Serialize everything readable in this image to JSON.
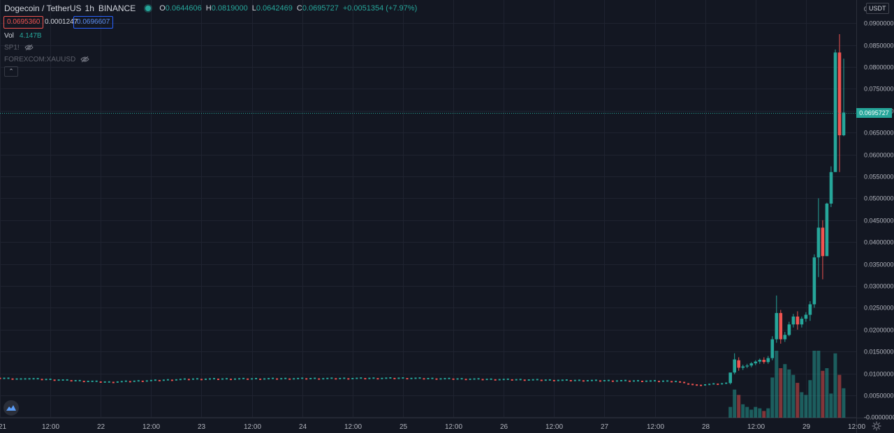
{
  "header": {
    "symbol": "Dogecoin / TetherUS",
    "interval": "1h",
    "exchange": "BINANCE",
    "ohlc": [
      {
        "label": "O",
        "value": "0.0644606"
      },
      {
        "label": "H",
        "value": "0.0819000"
      },
      {
        "label": "L",
        "value": "0.0642469"
      },
      {
        "label": "C",
        "value": "0.0695727"
      }
    ],
    "change": "+0.0051354 (+7.97%)"
  },
  "price_boxes": {
    "bid": "0.0695360",
    "spread": "0.0001247",
    "ask": "0.0696607"
  },
  "studies": {
    "vol_label": "Vol",
    "vol_value": "4.147B",
    "sp1": "SP1!",
    "xau": "FOREXCOM:XAUUSD"
  },
  "currency_badge": "USDT",
  "last_price_label": "0.0695727",
  "colors": {
    "background": "#131722",
    "up": "#26a69a",
    "down": "#ef5350",
    "grid": "#1f2330",
    "axis_text": "#b2b5be"
  },
  "icons": {
    "logo": "tradingview-logo-icon",
    "eye": "eye-crossed-icon",
    "collapse": "chevron-up-icon",
    "settings": "gear-icon"
  },
  "chart_data": {
    "type": "candlestick",
    "price_axis": {
      "ticks": [
        0.09,
        0.085,
        0.08,
        0.075,
        0.07,
        0.065,
        0.06,
        0.055,
        0.05,
        0.045,
        0.04,
        0.035,
        0.03,
        0.025,
        0.02,
        0.015,
        0.01,
        0.005,
        0.0
      ],
      "tick_labels": [
        "0.0900000",
        "0.0850000",
        "0.0800000",
        "0.0750000",
        "0.0700000",
        "0.0650000",
        "0.0600000",
        "0.0550000",
        "0.0500000",
        "0.0450000",
        "0.0400000",
        "0.0350000",
        "0.0300000",
        "0.0250000",
        "0.0200000",
        "0.0150000",
        "0.0100000",
        "0.0050000",
        "-0.0000000"
      ],
      "top_partial_label": "0.0",
      "range": [
        -0.0001,
        0.0953
      ]
    },
    "time_axis": {
      "range_hours": [
        -6,
        198
      ],
      "labels": [
        {
          "t": -6,
          "text": "21"
        },
        {
          "t": 6,
          "text": "12:00"
        },
        {
          "t": 18,
          "text": "22"
        },
        {
          "t": 30,
          "text": "12:00"
        },
        {
          "t": 42,
          "text": "23"
        },
        {
          "t": 54,
          "text": "12:00"
        },
        {
          "t": 66,
          "text": "24"
        },
        {
          "t": 78,
          "text": "12:00"
        },
        {
          "t": 90,
          "text": "25"
        },
        {
          "t": 102,
          "text": "12:00"
        },
        {
          "t": 114,
          "text": "26"
        },
        {
          "t": 126,
          "text": "12:00"
        },
        {
          "t": 138,
          "text": "27"
        },
        {
          "t": 150,
          "text": "12:00"
        },
        {
          "t": 162,
          "text": "28"
        },
        {
          "t": 174,
          "text": "12:00"
        },
        {
          "t": 186,
          "text": "29"
        },
        {
          "t": 198,
          "text": "12:00"
        }
      ]
    },
    "last_price": 0.0695727,
    "flat_segment": {
      "t_start": -6,
      "t_end": 167,
      "anchors": [
        [
          -6,
          0.0091
        ],
        [
          20,
          0.008
        ],
        [
          40,
          0.0087
        ],
        [
          90,
          0.0089
        ],
        [
          130,
          0.0084
        ],
        [
          155,
          0.0082
        ],
        [
          160,
          0.0073
        ],
        [
          167,
          0.0077
        ]
      ]
    },
    "candles": [
      {
        "t": 168,
        "o": 0.0078,
        "h": 0.0092,
        "l": 0.0075,
        "c": 0.0102,
        "v": 0.16
      },
      {
        "t": 169,
        "o": 0.0102,
        "h": 0.0146,
        "l": 0.0098,
        "c": 0.0132,
        "v": 0.42
      },
      {
        "t": 170,
        "o": 0.013,
        "h": 0.0137,
        "l": 0.0106,
        "c": 0.0113,
        "v": 0.34
      },
      {
        "t": 171,
        "o": 0.0113,
        "h": 0.012,
        "l": 0.0108,
        "c": 0.0116,
        "v": 0.2
      },
      {
        "t": 172,
        "o": 0.0116,
        "h": 0.0122,
        "l": 0.0112,
        "c": 0.0118,
        "v": 0.16
      },
      {
        "t": 173,
        "o": 0.0118,
        "h": 0.0126,
        "l": 0.0114,
        "c": 0.0123,
        "v": 0.12
      },
      {
        "t": 174,
        "o": 0.0123,
        "h": 0.013,
        "l": 0.0119,
        "c": 0.0127,
        "v": 0.16
      },
      {
        "t": 175,
        "o": 0.0127,
        "h": 0.0134,
        "l": 0.0122,
        "c": 0.0131,
        "v": 0.14
      },
      {
        "t": 176,
        "o": 0.0131,
        "h": 0.0137,
        "l": 0.0122,
        "c": 0.0126,
        "v": 0.1
      },
      {
        "t": 177,
        "o": 0.0126,
        "h": 0.014,
        "l": 0.0122,
        "c": 0.0135,
        "v": 0.14
      },
      {
        "t": 178,
        "o": 0.0135,
        "h": 0.0185,
        "l": 0.013,
        "c": 0.0178,
        "v": 0.6
      },
      {
        "t": 179,
        "o": 0.0178,
        "h": 0.0278,
        "l": 0.017,
        "c": 0.0238,
        "v": 1.0
      },
      {
        "t": 180,
        "o": 0.0238,
        "h": 0.0245,
        "l": 0.0168,
        "c": 0.0178,
        "v": 0.74
      },
      {
        "t": 181,
        "o": 0.0178,
        "h": 0.0195,
        "l": 0.0172,
        "c": 0.0188,
        "v": 0.8
      },
      {
        "t": 182,
        "o": 0.0188,
        "h": 0.0218,
        "l": 0.0185,
        "c": 0.0212,
        "v": 0.72
      },
      {
        "t": 183,
        "o": 0.0212,
        "h": 0.0236,
        "l": 0.0205,
        "c": 0.023,
        "v": 0.64
      },
      {
        "t": 184,
        "o": 0.023,
        "h": 0.0242,
        "l": 0.02,
        "c": 0.0212,
        "v": 0.52
      },
      {
        "t": 185,
        "o": 0.0212,
        "h": 0.023,
        "l": 0.0205,
        "c": 0.0225,
        "v": 0.38
      },
      {
        "t": 186,
        "o": 0.0225,
        "h": 0.024,
        "l": 0.0218,
        "c": 0.0234,
        "v": 0.34
      },
      {
        "t": 187,
        "o": 0.0234,
        "h": 0.0265,
        "l": 0.022,
        "c": 0.0258,
        "v": 0.56
      },
      {
        "t": 188,
        "o": 0.0258,
        "h": 0.0372,
        "l": 0.025,
        "c": 0.0365,
        "v": 1.0
      },
      {
        "t": 189,
        "o": 0.0365,
        "h": 0.05,
        "l": 0.032,
        "c": 0.0433,
        "v": 1.0
      },
      {
        "t": 190,
        "o": 0.0433,
        "h": 0.045,
        "l": 0.0315,
        "c": 0.0368,
        "v": 0.7
      },
      {
        "t": 191,
        "o": 0.0368,
        "h": 0.049,
        "l": 0.0368,
        "c": 0.0488,
        "v": 0.74
      },
      {
        "t": 192,
        "o": 0.0488,
        "h": 0.0573,
        "l": 0.048,
        "c": 0.056,
        "v": 0.36
      },
      {
        "t": 193,
        "o": 0.056,
        "h": 0.084,
        "l": 0.056,
        "c": 0.0833,
        "v": 0.96
      },
      {
        "t": 194,
        "o": 0.0833,
        "h": 0.0875,
        "l": 0.056,
        "c": 0.0644,
        "v": 0.64
      },
      {
        "t": 195,
        "o": 0.0644,
        "h": 0.0819,
        "l": 0.0642,
        "c": 0.0696,
        "v": 0.44
      }
    ]
  }
}
